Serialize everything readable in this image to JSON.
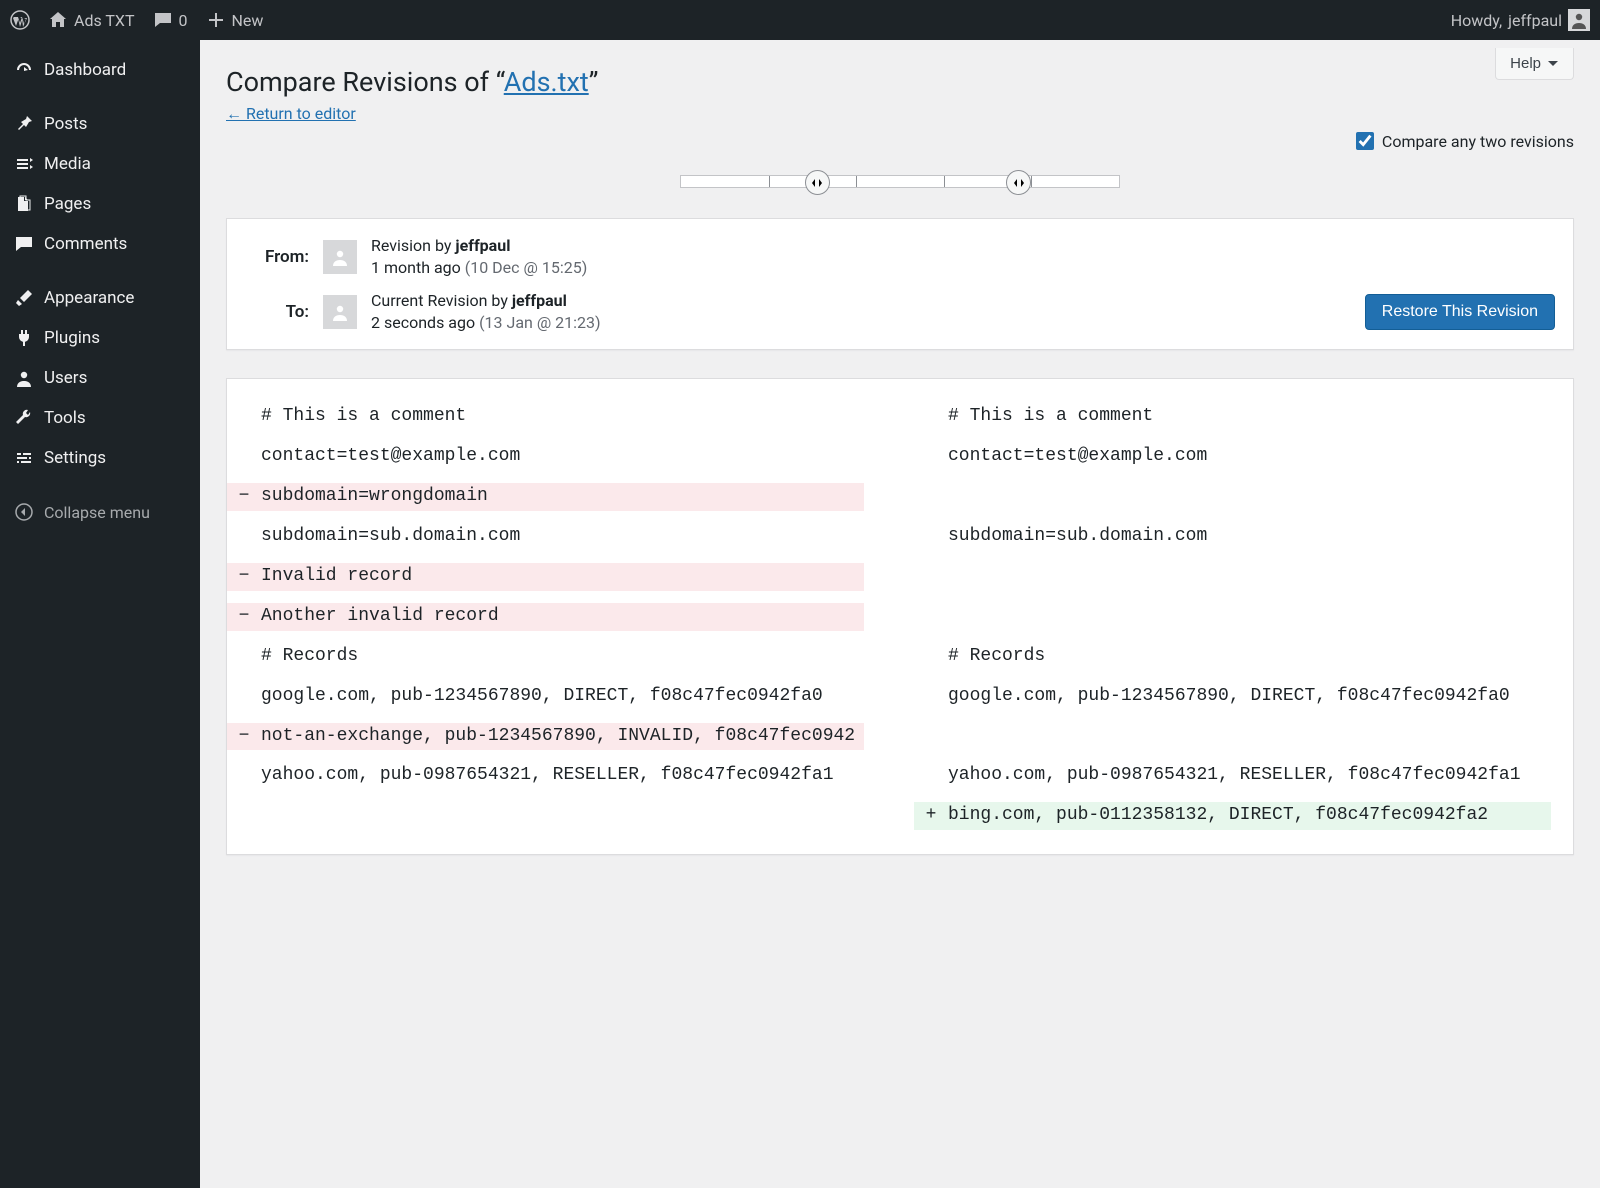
{
  "adminbar": {
    "site_name": "Ads TXT",
    "comment_count": "0",
    "new_label": "New",
    "howdy_prefix": "Howdy, ",
    "user": "jeffpaul"
  },
  "sidebar": {
    "items": [
      {
        "label": "Dashboard",
        "icon": "gauge"
      },
      {
        "label": "Posts",
        "icon": "pin"
      },
      {
        "label": "Media",
        "icon": "media"
      },
      {
        "label": "Pages",
        "icon": "pages"
      },
      {
        "label": "Comments",
        "icon": "comment"
      },
      {
        "label": "Appearance",
        "icon": "brush"
      },
      {
        "label": "Plugins",
        "icon": "plug"
      },
      {
        "label": "Users",
        "icon": "user"
      },
      {
        "label": "Tools",
        "icon": "wrench"
      },
      {
        "label": "Settings",
        "icon": "sliders"
      }
    ],
    "collapse_label": "Collapse menu"
  },
  "header": {
    "help_label": "Help",
    "title_prefix": "Compare Revisions of “",
    "title_link": "Ads.txt",
    "title_suffix": "”",
    "return_link": "← Return to editor",
    "compare_any_label": "Compare any two revisions"
  },
  "slider": {
    "ticks": 5,
    "handle_left_pct": 31,
    "handle_right_pct": 77
  },
  "revmeta": {
    "from_label": "From:",
    "to_label": "To:",
    "from": {
      "prefix": "Revision by ",
      "author": "jeffpaul",
      "ago": "1 month ago",
      "ts": "(10 Dec @ 15:25)"
    },
    "to": {
      "prefix": "Current Revision by ",
      "author": "jeffpaul",
      "ago": "2 seconds ago",
      "ts": "(13 Jan @ 21:23)"
    },
    "restore_label": "Restore This Revision"
  },
  "diff": {
    "rows": [
      {
        "type": "ctx",
        "left": "# This is a comment",
        "right": "# This is a comment"
      },
      {
        "type": "blank"
      },
      {
        "type": "ctx",
        "left": "contact=test@example.com",
        "right": "contact=test@example.com"
      },
      {
        "type": "blank"
      },
      {
        "type": "del",
        "left": "subdomain=wrongdomain",
        "right": ""
      },
      {
        "type": "blank"
      },
      {
        "type": "ctx",
        "left": "subdomain=sub.domain.com",
        "right": "subdomain=sub.domain.com"
      },
      {
        "type": "blank"
      },
      {
        "type": "del",
        "left": "Invalid record",
        "right": ""
      },
      {
        "type": "blank"
      },
      {
        "type": "del",
        "left": "Another invalid record",
        "right": ""
      },
      {
        "type": "blank"
      },
      {
        "type": "ctx",
        "left": "# Records",
        "right": "# Records"
      },
      {
        "type": "blank"
      },
      {
        "type": "ctx",
        "left": "google.com, pub-1234567890, DIRECT, f08c47fec0942fa0",
        "right": "google.com, pub-1234567890, DIRECT, f08c47fec0942fa0"
      },
      {
        "type": "blank"
      },
      {
        "type": "del",
        "left": "not-an-exchange, pub-1234567890, INVALID, f08c47fec0942",
        "right": ""
      },
      {
        "type": "blank"
      },
      {
        "type": "ctx",
        "left": "yahoo.com, pub-0987654321, RESELLER, f08c47fec0942fa1",
        "right": "yahoo.com, pub-0987654321, RESELLER, f08c47fec0942fa1"
      },
      {
        "type": "blank"
      },
      {
        "type": "add",
        "left": "",
        "right": "bing.com, pub-0112358132, DIRECT, f08c47fec0942fa2"
      }
    ]
  }
}
